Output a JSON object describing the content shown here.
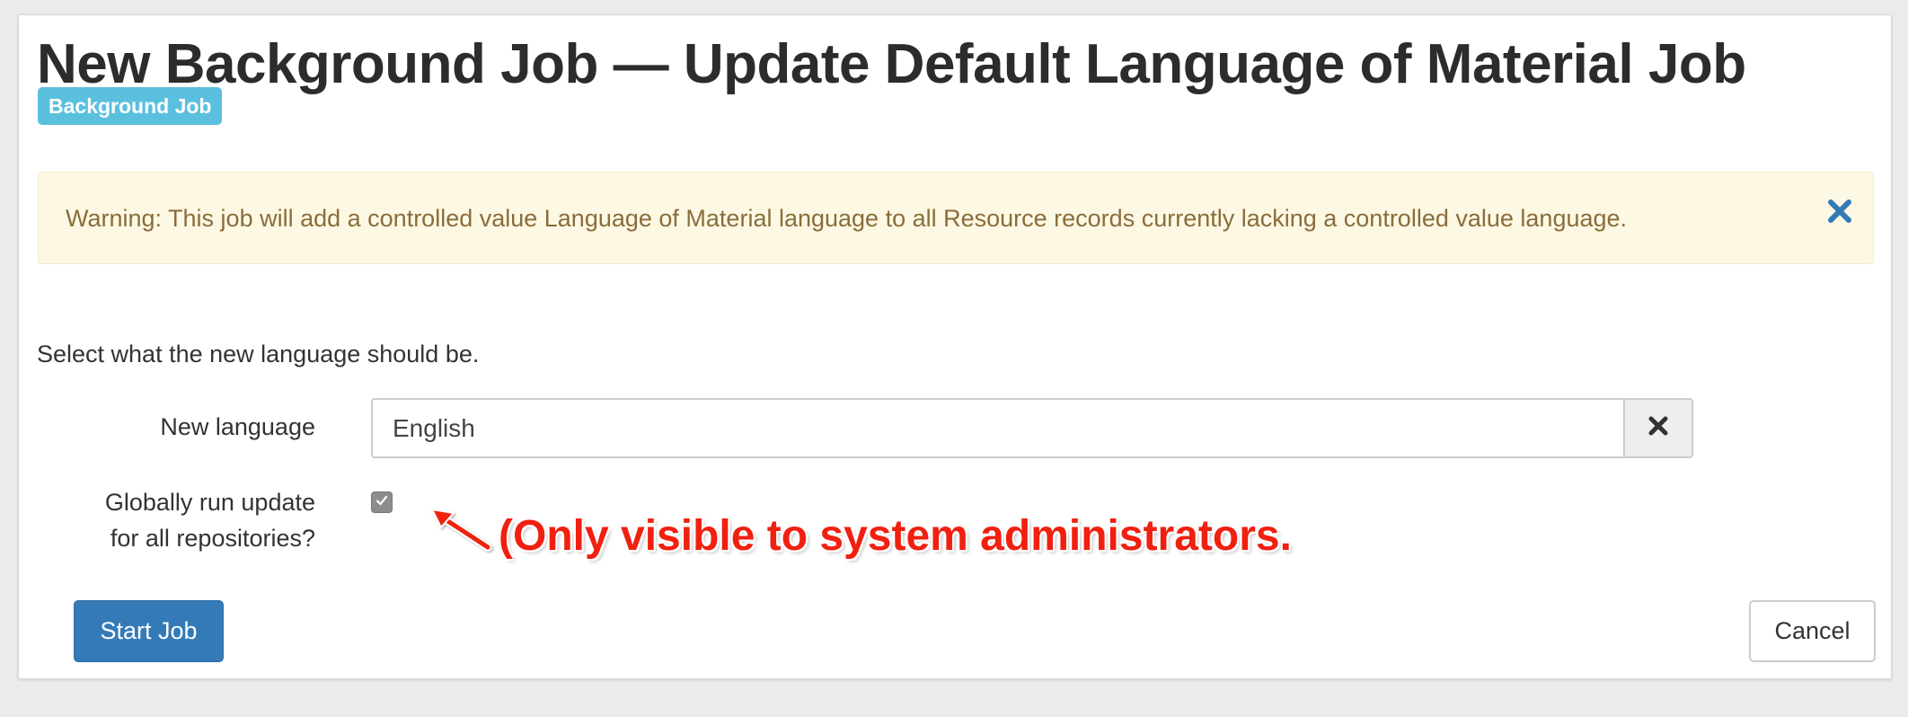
{
  "header": {
    "title": "New Background Job — Update Default Language of Material Job",
    "badge": "Background Job"
  },
  "alert": {
    "message": "Warning: This job will add a controlled value Language of Material language to all Resource records currently lacking a controlled value language.",
    "close_icon": "close-icon"
  },
  "form": {
    "instructions": "Select what the new language should be.",
    "language_label": "New language",
    "language_value": "English",
    "clear_icon": "clear-icon",
    "global_label_line1": "Globally run update",
    "global_label_line2": "for all repositories?",
    "global_checked": true
  },
  "annotation": {
    "text": "(Only visible to system administrators."
  },
  "actions": {
    "start_label": "Start Job",
    "cancel_label": "Cancel"
  },
  "colors": {
    "badge": "#5bc0de",
    "primary": "#337ab7",
    "alert_bg": "#fcf8e3",
    "alert_text": "#8a6d3b",
    "annotation": "#f02010"
  }
}
